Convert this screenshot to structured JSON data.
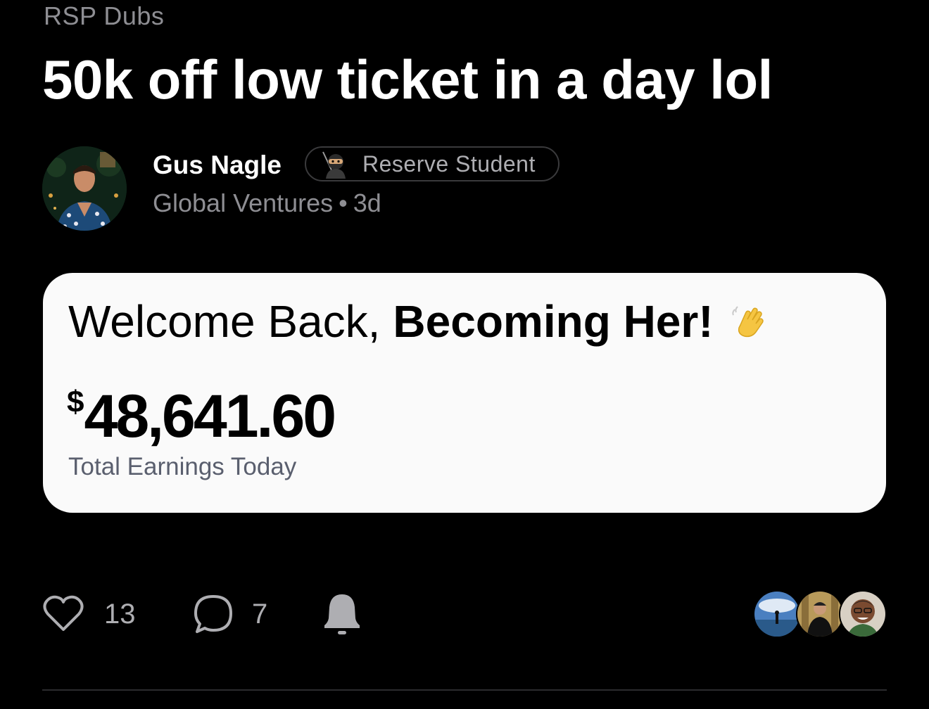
{
  "post": {
    "category": "RSP Dubs",
    "title": "50k off low ticket in a day lol",
    "author": {
      "name": "Gus Nagle",
      "badge_label": "Reserve Student",
      "badge_icon": "ninja-emoji",
      "group": "Global Ventures",
      "separator": "•",
      "age": "3d"
    },
    "image_card": {
      "greeting_prefix": "Welcome Back,",
      "greeting_name": "Becoming Her!",
      "greeting_icon": "waving-hand-emoji",
      "currency_symbol": "$",
      "amount": "48,641.60",
      "amount_label": "Total Earnings Today"
    },
    "actions": {
      "like_count": "13",
      "comment_count": "7",
      "like_icon": "heart-outline-icon",
      "comment_icon": "speech-bubble-icon",
      "notify_icon": "bell-icon"
    }
  },
  "colors": {
    "background": "#000000",
    "muted_text": "#8e8e93",
    "card_background": "#fafafa",
    "card_label": "#5a5f6e"
  }
}
